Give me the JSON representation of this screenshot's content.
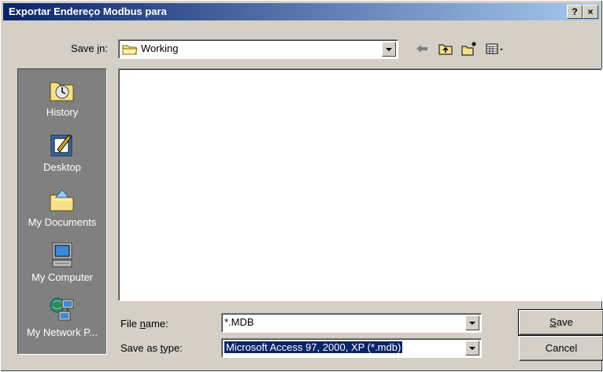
{
  "window": {
    "title": "Exportar Endereço Modbus para",
    "help_btn": "?",
    "close_btn": "×"
  },
  "save_in": {
    "label_pre": "Save ",
    "label_accel": "i",
    "label_post": "n:",
    "value": "Working"
  },
  "places": [
    {
      "label": "History"
    },
    {
      "label": "Desktop"
    },
    {
      "label": "My Documents"
    },
    {
      "label": "My Computer"
    },
    {
      "label": "My Network P..."
    }
  ],
  "file_name": {
    "label_pre": "File ",
    "label_accel": "n",
    "label_post": "ame:",
    "value": "*.MDB"
  },
  "save_as_type": {
    "label_pre": "Save as ",
    "label_accel": "t",
    "label_post": "ype:",
    "value": "Microsoft Access 97, 2000, XP (*.mdb)"
  },
  "buttons": {
    "save_accel": "S",
    "save_rest": "ave",
    "cancel": "Cancel"
  },
  "toolbar_icons": [
    "back-arrow-icon",
    "up-folder-icon",
    "new-folder-icon",
    "view-menu-icon"
  ]
}
